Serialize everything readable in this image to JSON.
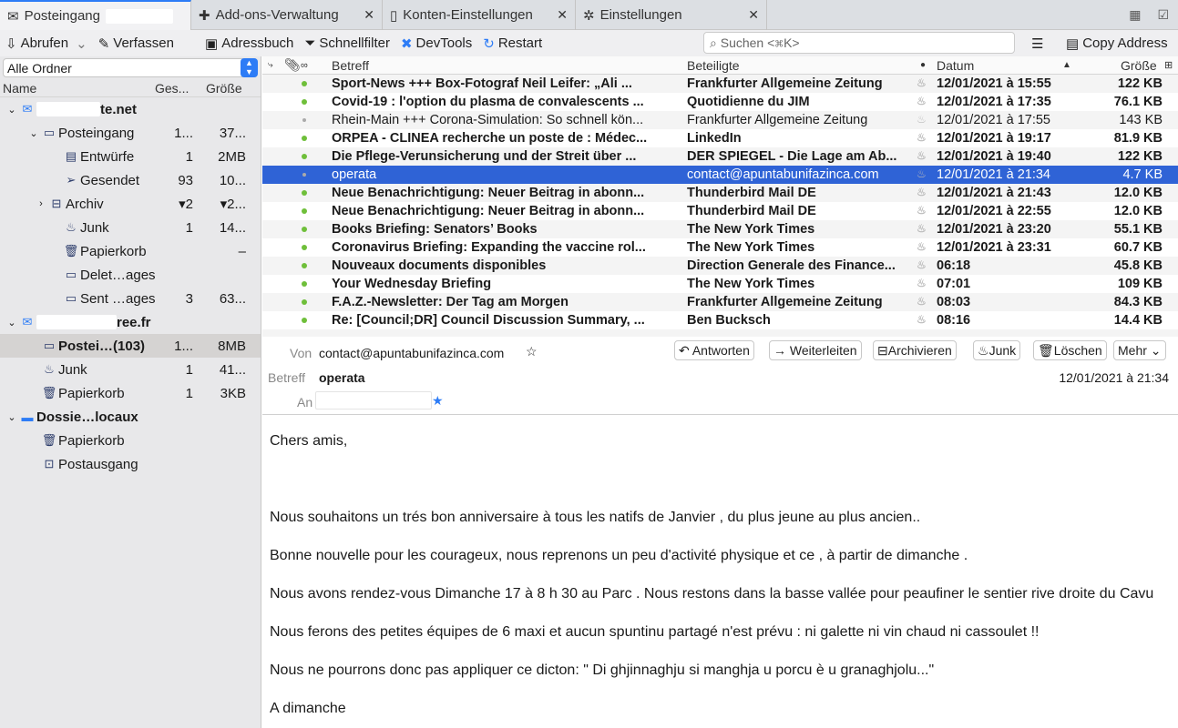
{
  "tabs": [
    {
      "label": "Posteingang",
      "icon": "inbox-icon"
    },
    {
      "label": "Add-ons-Verwaltung",
      "icon": "puzzle-icon"
    },
    {
      "label": "Konten-Einstellungen",
      "icon": "account-settings-icon"
    },
    {
      "label": "Einstellungen",
      "icon": "gear-icon"
    }
  ],
  "toolbar": {
    "get_mail": "Abrufen",
    "compose": "Verfassen",
    "address_book": "Adressbuch",
    "quick_filter": "Schnellfilter",
    "devtools": "DevTools",
    "restart": "Restart",
    "search_placeholder": "Suchen <⌘K>",
    "copy_address": "Copy Address"
  },
  "folder_pane": {
    "selector": "Alle Ordner",
    "col_name": "Name",
    "col_total": "Ges...",
    "col_size": "Größe",
    "folders": [
      {
        "name": "te.net",
        "total": "",
        "size": "",
        "bold": true
      },
      {
        "name": "Posteingang",
        "total": "1...",
        "size": "37..."
      },
      {
        "name": "Entwürfe",
        "total": "1",
        "size": "2MB"
      },
      {
        "name": "Gesendet",
        "total": "93",
        "size": "10..."
      },
      {
        "name": "Archiv",
        "total": "▾2",
        "size": "▾2..."
      },
      {
        "name": "Junk",
        "total": "1",
        "size": "14..."
      },
      {
        "name": "Papierkorb",
        "total": "",
        "size": "–"
      },
      {
        "name": "Delet…ages",
        "total": "",
        "size": ""
      },
      {
        "name": "Sent …ages",
        "total": "3",
        "size": "63..."
      },
      {
        "name": "ree.fr",
        "total": "",
        "size": "",
        "bold": true
      },
      {
        "name": "Postei…(103)",
        "total": "1...",
        "size": "8MB",
        "bold": true
      },
      {
        "name": "Junk",
        "total": "1",
        "size": "41..."
      },
      {
        "name": "Papierkorb",
        "total": "1",
        "size": "3KB"
      },
      {
        "name": "Dossie…locaux",
        "total": "",
        "size": "",
        "bold": true
      },
      {
        "name": "Papierkorb",
        "total": "",
        "size": ""
      },
      {
        "name": "Postausgang",
        "total": "",
        "size": ""
      }
    ]
  },
  "message_list": {
    "columns": {
      "subject": "Betreff",
      "correspondents": "Beteiligte",
      "date": "Datum",
      "size": "Größe"
    },
    "rows": [
      {
        "subject": "Sport-News +++ Box-Fotograf Neil Leifer: „Ali ...",
        "from": "Frankfurter Allgemeine Zeitung",
        "date": "12/01/2021 à 15:55",
        "size": "122 KB",
        "unread": true
      },
      {
        "subject": "Covid-19 : l'option du plasma de convalescents ...",
        "from": "Quotidienne du JIM",
        "date": "12/01/2021 à 17:35",
        "size": "76.1 KB",
        "unread": true
      },
      {
        "subject": "Rhein-Main +++ Corona-Simulation: So schnell kön...",
        "from": "Frankfurter Allgemeine Zeitung",
        "date": "12/01/2021 à 17:55",
        "size": "143 KB",
        "unread": false
      },
      {
        "subject": "ORPEA - CLINEA recherche un poste de : Médec...",
        "from": "LinkedIn",
        "date": "12/01/2021 à 19:17",
        "size": "81.9 KB",
        "unread": true
      },
      {
        "subject": "Die Pflege-Verunsicherung und der Streit über ...",
        "from": "DER SPIEGEL - Die Lage am Ab...",
        "date": "12/01/2021 à 19:40",
        "size": "122 KB",
        "unread": true
      },
      {
        "subject": "operata",
        "from": "contact@apuntabunifazinca.com",
        "date": "12/01/2021 à 21:34",
        "size": "4.7 KB",
        "unread": false,
        "selected": true
      },
      {
        "subject": "Neue Benachrichtigung: Neuer Beitrag in abonn...",
        "from": "Thunderbird Mail DE",
        "date": "12/01/2021 à 21:43",
        "size": "12.0 KB",
        "unread": true
      },
      {
        "subject": "Neue Benachrichtigung: Neuer Beitrag in abonn...",
        "from": "Thunderbird Mail DE",
        "date": "12/01/2021 à 22:55",
        "size": "12.0 KB",
        "unread": true
      },
      {
        "subject": "Books Briefing: Senators’ Books",
        "from": "The New York Times",
        "date": "12/01/2021 à 23:20",
        "size": "55.1 KB",
        "unread": true
      },
      {
        "subject": "Coronavirus Briefing: Expanding the vaccine rol...",
        "from": "The New York Times",
        "date": "12/01/2021 à 23:31",
        "size": "60.7 KB",
        "unread": true
      },
      {
        "subject": "Nouveaux documents disponibles",
        "from": "Direction Generale des Finance...",
        "date": "06:18",
        "size": "45.8 KB",
        "unread": true
      },
      {
        "subject": "Your Wednesday Briefing",
        "from": "The New York Times",
        "date": "07:01",
        "size": "109 KB",
        "unread": true
      },
      {
        "subject": "F.A.Z.-Newsletter: Der Tag am Morgen",
        "from": "Frankfurter Allgemeine Zeitung",
        "date": "08:03",
        "size": "84.3 KB",
        "unread": true
      },
      {
        "subject": "Re: [Council;DR] Council Discussion Summary, ...",
        "from": "Ben Bucksch",
        "date": "08:16",
        "size": "14.4 KB",
        "unread": true
      }
    ]
  },
  "header": {
    "from_label": "Von",
    "from": "contact@apuntabunifazinca.com",
    "subject_label": "Betreff",
    "subject": "operata",
    "to_label": "An",
    "date": "12/01/2021 à 21:34",
    "buttons": {
      "reply": "↶ Antworten",
      "forward": "→ Weiterleiten",
      "archive": "Archivieren",
      "junk": "Junk",
      "delete": "Löschen",
      "more": "Mehr ⌄"
    }
  },
  "body": [
    "Chers amis,",
    "",
    "Nous souhaitons un trés bon anniversaire à tous les natifs de Janvier , du plus jeune au plus ancien..",
    "Bonne nouvelle pour les courageux, nous reprenons un peu d'activité physique et ce , à partir de dimanche .",
    "Nous avons rendez-vous Dimanche 17 à 8 h 30 au Parc . Nous restons dans la basse vallée pour peaufiner le sentier rive droite du Cavu",
    "Nous ferons des petites équipes de 6 maxi et aucun spuntinu partagé n'est prévu : ni galette ni vin chaud ni cassoulet !!",
    "Nous ne pourrons donc pas  appliquer ce dicton: \" Di ghjinnaghju si manghja u porcu è u granaghjolu...\"",
    "A dimanche"
  ]
}
